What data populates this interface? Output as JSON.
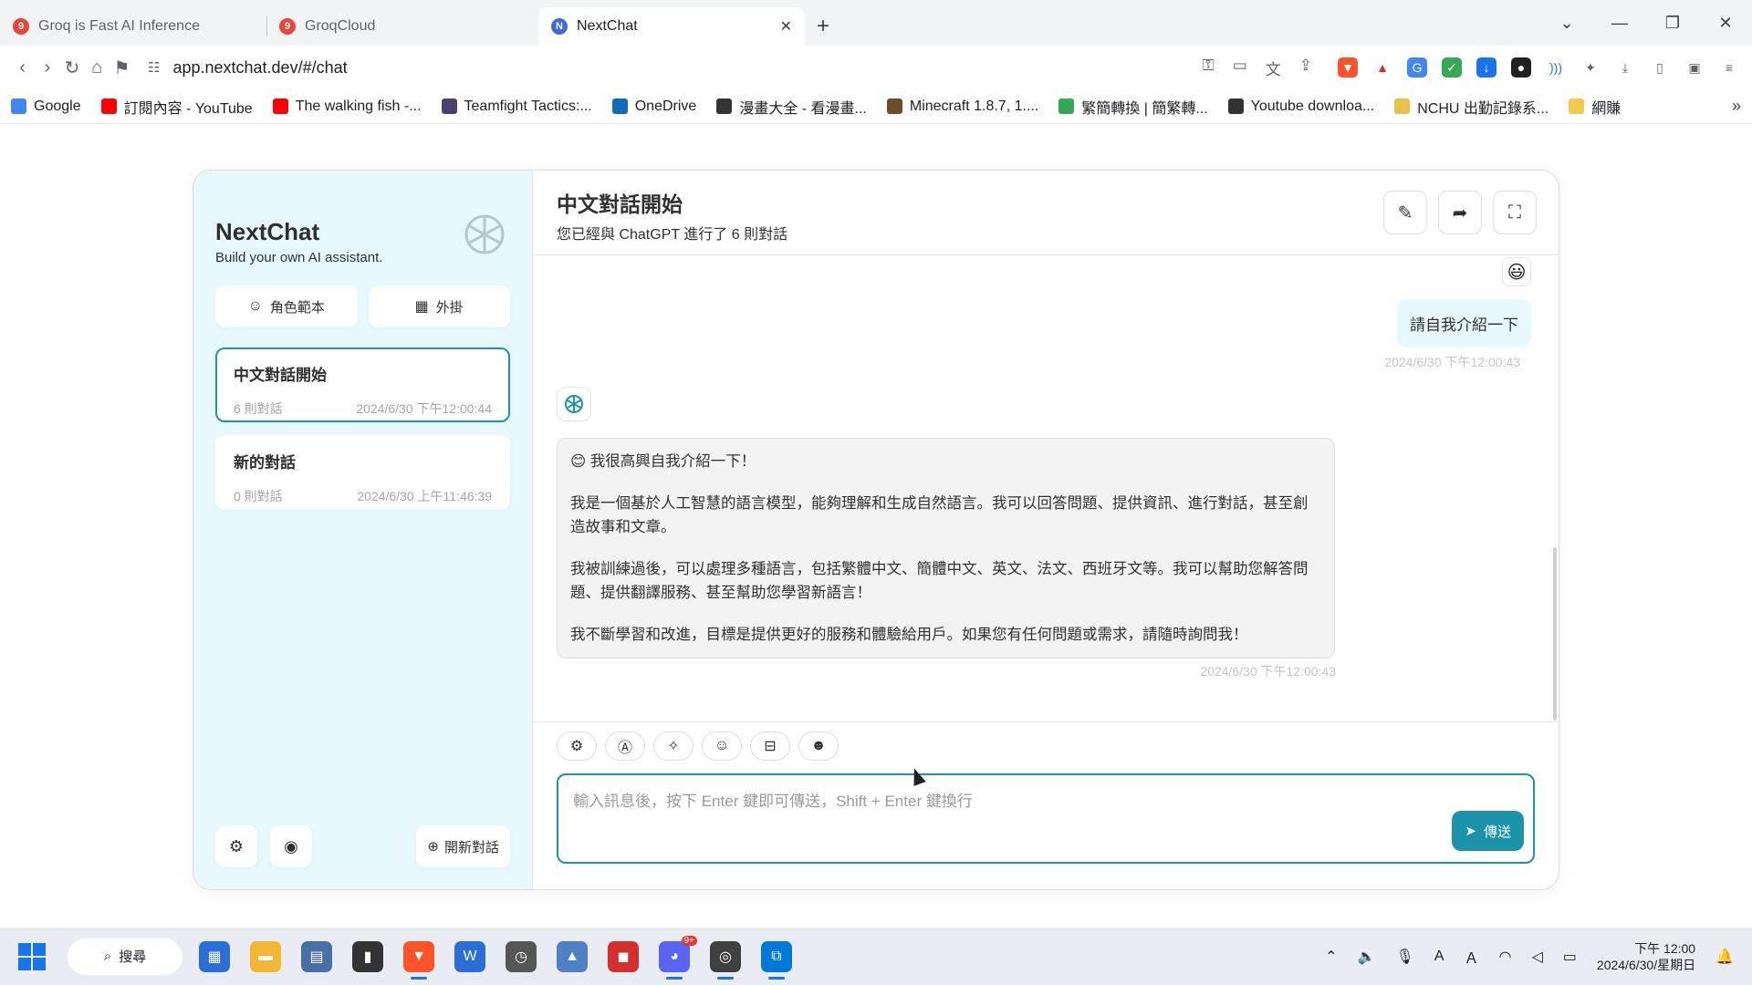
{
  "browser": {
    "tabs": [
      {
        "title": "Groq is Fast AI Inference",
        "favicon": "9",
        "active": false
      },
      {
        "title": "GroqCloud",
        "favicon": "9",
        "active": false
      },
      {
        "title": "NextChat",
        "favicon": "N",
        "active": true
      }
    ],
    "url": "app.nextchat.dev/#/chat",
    "bookmarks": [
      {
        "label": "Google",
        "color": "#4285f4"
      },
      {
        "label": "訂閱內容 - YouTube",
        "color": "#ff0000"
      },
      {
        "label": "The walking fish -...",
        "color": "#ff0000"
      },
      {
        "label": "Teamfight Tactics:...",
        "color": "#4b3f72"
      },
      {
        "label": "OneDrive",
        "color": "#0f6cbd"
      },
      {
        "label": "漫畫大全 - 看漫畫...",
        "color": "#333333"
      },
      {
        "label": "Minecraft 1.8.7, 1....",
        "color": "#6b4f2a"
      },
      {
        "label": "繁簡轉換 | 簡繁轉...",
        "color": "#34a853"
      },
      {
        "label": "Youtube downloa...",
        "color": "#333333"
      },
      {
        "label": "NCHU 出勤記錄系...",
        "color": "#e6c34a"
      },
      {
        "label": "網賺",
        "color": "#f2c94c"
      }
    ]
  },
  "sidebar": {
    "title": "NextChat",
    "subtitle": "Build your own AI assistant.",
    "mask_button": "角色範本",
    "plugin_button": "外掛",
    "chats": [
      {
        "title": "中文對話開始",
        "count": "6 則對話",
        "time": "2024/6/30 下午12:00:44",
        "selected": true
      },
      {
        "title": "新的對話",
        "count": "0 則對話",
        "time": "2024/6/30 上午11:46:39",
        "selected": false
      }
    ],
    "new_chat_button": "開新對話"
  },
  "chat": {
    "title": "中文對話開始",
    "subtitle": "您已經與 ChatGPT 進行了 6 則對話",
    "user_avatar": "😃",
    "user_message": "請自我介紹一下",
    "user_time": "2024/6/30 下午12:00:43",
    "bot_paragraphs": [
      "😊 我很高興自我介紹一下！",
      "我是一個基於人工智慧的語言模型，能夠理解和生成自然語言。我可以回答問題、提供資訊、進行對話，甚至創造故事和文章。",
      "我被訓練過後，可以處理多種語言，包括繁體中文、簡體中文、英文、法文、西班牙文等。我可以幫助您解答問題、提供翻譯服務、甚至幫助您學習新語言！",
      "我不斷學習和改進，目標是提供更好的服務和體驗給用戶。如果您有任何問題或需求，請隨時詢問我！"
    ],
    "bot_time": "2024/6/30 下午12:00:43"
  },
  "input": {
    "placeholder": "輸入訊息後，按下 Enter 鍵即可傳送，Shift + Enter 鍵換行",
    "send_label": "傳送"
  },
  "taskbar": {
    "search_label": "搜尋",
    "discord_badge": "9+",
    "time": "下午 12:00",
    "date": "2024/6/30/星期日"
  },
  "colors": {
    "accent": "#1d93ab",
    "sidebar_bg": "#e7f8ff",
    "bot_bubble": "#f3f3f3"
  }
}
